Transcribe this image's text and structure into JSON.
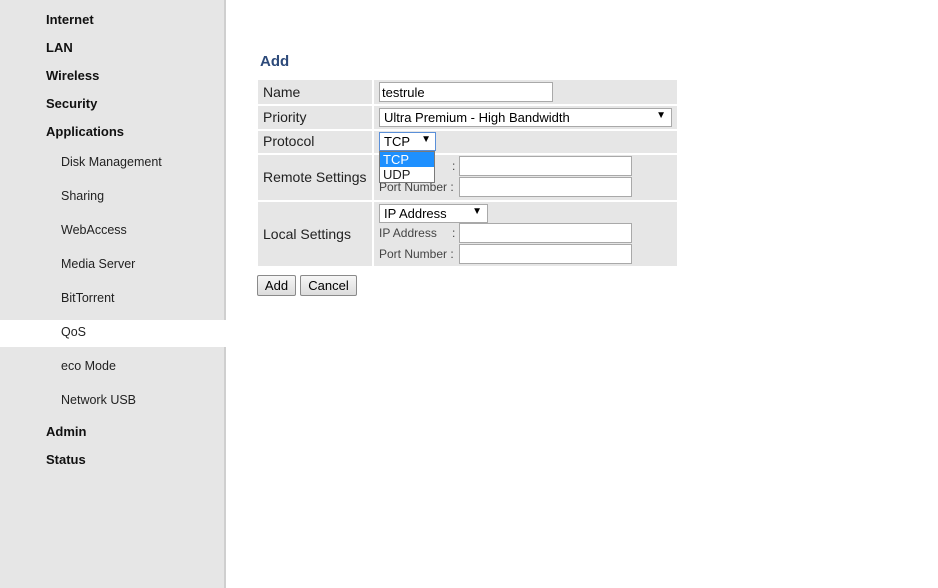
{
  "sidebar": {
    "top_items": [
      "Internet",
      "LAN",
      "Wireless",
      "Security",
      "Applications"
    ],
    "sub_items": [
      "Disk Management",
      "Sharing",
      "WebAccess",
      "Media Server",
      "BitTorrent",
      "QoS",
      "eco Mode",
      "Network USB"
    ],
    "bottom_items": [
      "Admin",
      "Status"
    ],
    "active": "QoS"
  },
  "main": {
    "title": "Add",
    "form": {
      "name_label": "Name",
      "name_value": "testrule",
      "priority_label": "Priority",
      "priority_value": "Ultra Premium - High Bandwidth",
      "protocol_label": "Protocol",
      "protocol_value": "TCP",
      "protocol_options": [
        "TCP",
        "UDP"
      ],
      "remote_label": "Remote Settings",
      "remote_colon": ":",
      "remote_port_label": "Port Number :",
      "local_label": "Local Settings",
      "local_select_value": "IP Address",
      "local_ip_label": "IP Address",
      "local_ip_colon": ":",
      "local_port_label": "Port Number :"
    },
    "buttons": {
      "add": "Add",
      "cancel": "Cancel"
    }
  },
  "colors": {
    "sidebar_bg": "#e6e6e6",
    "title": "#2d4a7a",
    "option_highlight": "#1e90ff"
  }
}
